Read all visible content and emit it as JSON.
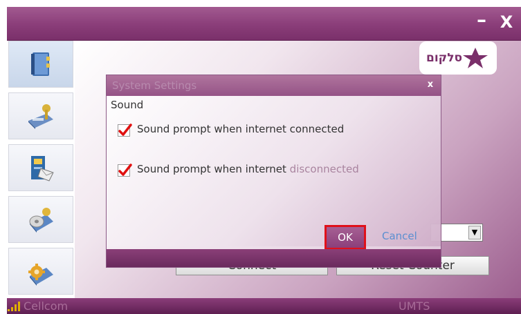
{
  "window": {
    "minimize_label": "–",
    "close_label": "X"
  },
  "sidebar": {
    "items": [
      {
        "icon": "address-book-icon",
        "active": true
      },
      {
        "icon": "sms-messages-icon",
        "active": false
      },
      {
        "icon": "phonebook-contacts-icon",
        "active": false
      },
      {
        "icon": "connection-disc-icon",
        "active": false
      },
      {
        "icon": "settings-gear-icon",
        "active": false
      }
    ]
  },
  "logo": {
    "text": "סלקום",
    "icon": "cellcom-star-icon"
  },
  "main": {
    "connect_label": "Connect",
    "reset_counter_label": "Reset Counter"
  },
  "status": {
    "carrier": "Cellcom",
    "network_type": "UMTS"
  },
  "dialog": {
    "title": "System Settings",
    "close_label": "x",
    "section_label": "Sound",
    "options": [
      {
        "prefix": "Sound prompt when internet connected",
        "suffix": "",
        "checked": true
      },
      {
        "prefix": "Sound prompt when internet ",
        "suffix": "disconnected",
        "checked": true
      }
    ],
    "ok_label": "OK",
    "cancel_label": "Cancel"
  },
  "colors": {
    "brand_purple": "#8a3d79",
    "highlight_red": "#e0101a",
    "check_red": "#e01010",
    "cancel_blue": "#5b8fd0"
  }
}
